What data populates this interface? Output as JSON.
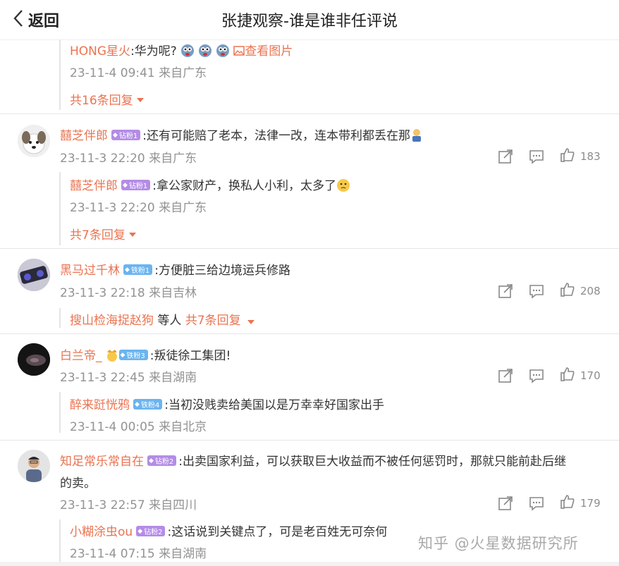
{
  "header": {
    "back_label": "返回",
    "title": "张捷观察-谁是谁非任评说"
  },
  "thread0": {
    "reply": {
      "user": "HONG星火",
      "text": ":华为呢?",
      "image_link": "查看图片",
      "time": "23-11-4 09:41 来自广东"
    },
    "more": "共16条回复"
  },
  "comments": [
    {
      "user": "囍芝伴郎",
      "badge": "钻粉1",
      "text": ":还有可能赔了老本，法律一改，连本带利都丢在那",
      "time": "23-11-3 22:20 来自广东",
      "likes": "183",
      "reply": {
        "user": "囍芝伴郎",
        "badge": "钻粉1",
        "text": ":拿公家财产，换私人小利，太多了",
        "time": "23-11-3 22:20 来自广东"
      },
      "more": "共7条回复"
    },
    {
      "user": "黑马过千林",
      "badge": "铁粉1",
      "text": ":方便脏三给边境运兵修路",
      "time": "23-11-3 22:18 来自吉林",
      "likes": "208",
      "reply_summary": {
        "user": "搜山检海捉赵狗",
        "middle": " 等人 ",
        "more": "共7条回复"
      }
    },
    {
      "user": "白兰帝_",
      "badge": "铁粉3",
      "text": ":叛徒徐工集团!",
      "time": "23-11-3 22:45 来自湖南",
      "likes": "170",
      "reply": {
        "user": "醉来跹恍鸦",
        "badge": "铁粉4",
        "text": ":当初没贱卖给美国以是万幸幸好国家出手",
        "time": "23-11-4 00:05 来自北京"
      }
    },
    {
      "user": "知足常乐常自在",
      "badge": "钻粉2",
      "text_line1": ":出卖国家利益，可以获取巨大收益而不被任何惩罚时，那就只能前赴后继",
      "text_line2": "的卖。",
      "time": "23-11-3 22:57 来自四川",
      "likes": "179",
      "reply": {
        "user": "小糊涂虫ou",
        "badge": "钻粉2",
        "text": ":这话说到关键点了，可是老百姓无可奈何",
        "time": "23-11-4 07:15 来自湖南"
      }
    }
  ],
  "watermark": "知乎 @火星数据研究所",
  "colors": {
    "username": "#eb7350",
    "meta": "#939393",
    "diamond_badge": "#b48ce6",
    "iron_badge": "#6ab4f0"
  }
}
